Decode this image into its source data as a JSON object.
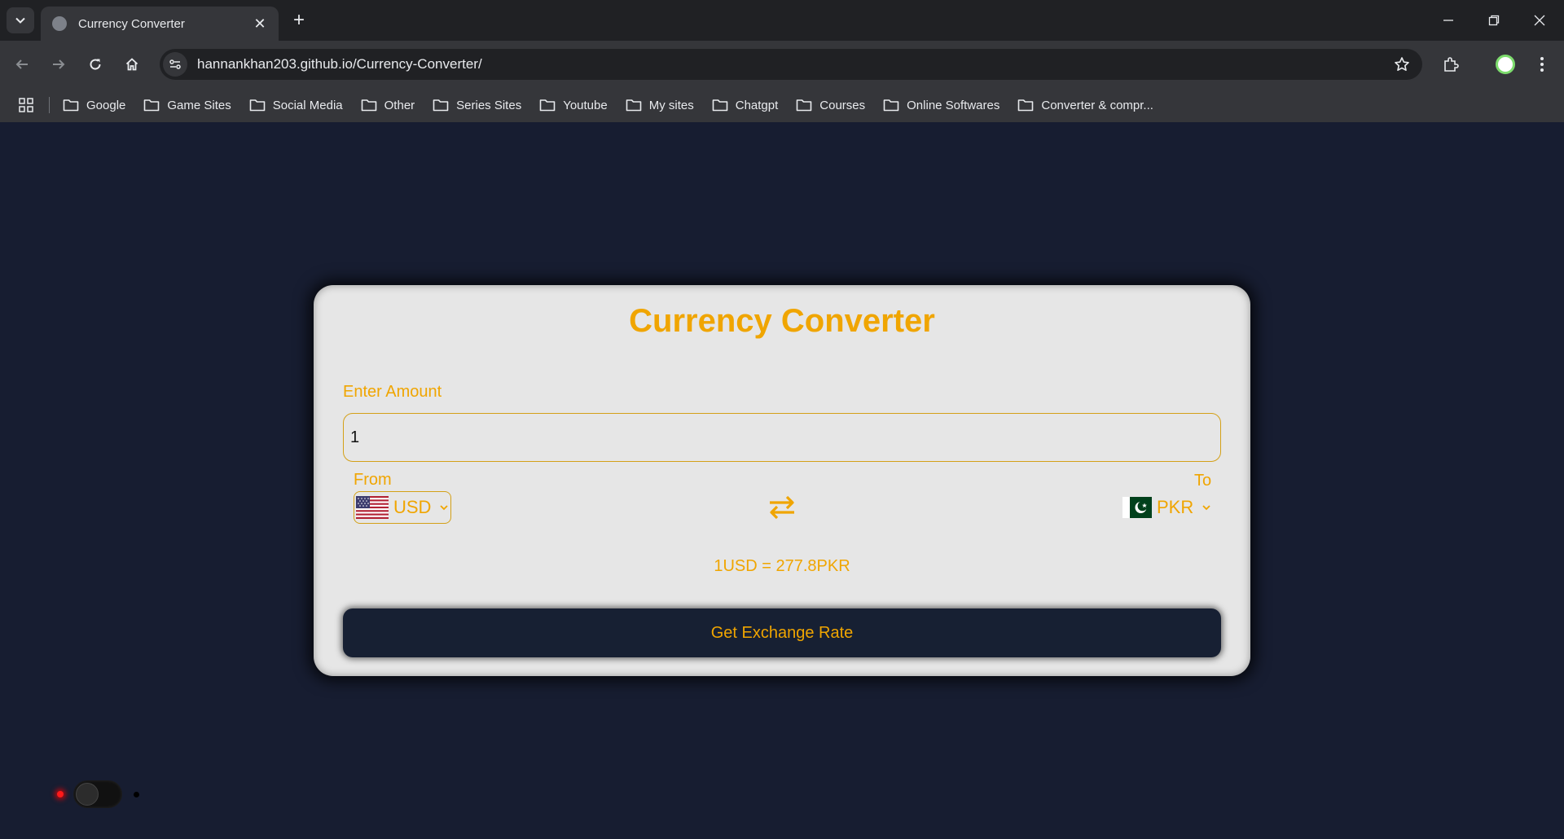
{
  "browser": {
    "tab_title": "Currency Converter",
    "url": "hannankhan203.github.io/Currency-Converter/",
    "bookmarks": [
      {
        "label": "Google"
      },
      {
        "label": "Game Sites"
      },
      {
        "label": "Social Media"
      },
      {
        "label": "Other"
      },
      {
        "label": "Series Sites"
      },
      {
        "label": "Youtube"
      },
      {
        "label": "My sites"
      },
      {
        "label": "Chatgpt"
      },
      {
        "label": "Courses"
      },
      {
        "label": "Online Softwares"
      },
      {
        "label": "Converter & compr..."
      }
    ]
  },
  "converter": {
    "title": "Currency Converter",
    "amount_label": "Enter Amount",
    "amount_value": "1",
    "from_label": "From",
    "to_label": "To",
    "from_currency": "USD",
    "to_currency": "PKR",
    "rate_message": "1USD = 277.8PKR",
    "button_label": "Get Exchange Rate"
  },
  "colors": {
    "accent": "#f0a500",
    "page_background": "#171d31",
    "card_background": "#e6e6e6",
    "button_background": "#172033"
  },
  "icons": {
    "swap": "swap-arrows-icon",
    "from_flag": "us-flag-icon",
    "to_flag": "pakistan-flag-icon"
  }
}
